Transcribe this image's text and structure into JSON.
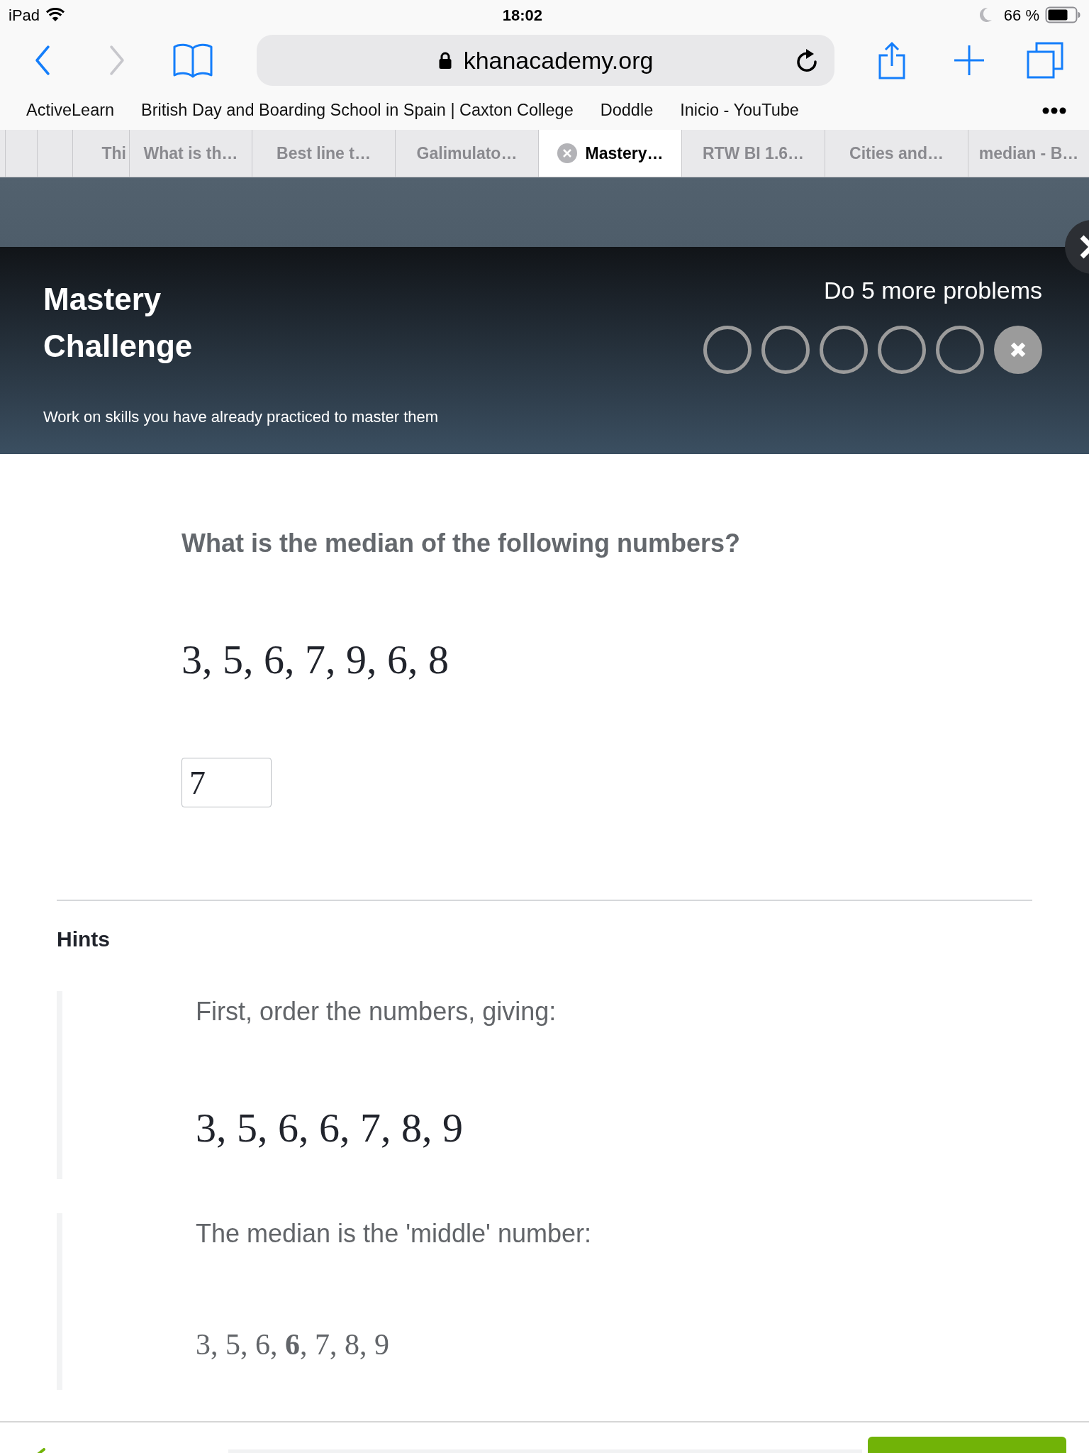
{
  "status_bar": {
    "device": "iPad",
    "time": "18:02",
    "battery": "66 %"
  },
  "toolbar": {
    "buttons": [
      {
        "kind": "back",
        "disabled": false
      },
      {
        "kind": "forward",
        "disabled": true
      },
      {
        "kind": "bookmarks",
        "disabled": false
      }
    ],
    "url": "khanacademy.org",
    "actions": [
      {
        "kind": "share"
      },
      {
        "kind": "new_tab"
      },
      {
        "kind": "tabs"
      }
    ]
  },
  "bookmarks": [
    "ActiveLearn",
    "British Day and Boarding School in Spain | Caxton College",
    "Doddle",
    "Inicio - YouTube"
  ],
  "tabs": [
    {
      "kind": "stub",
      "selected": false
    },
    {
      "kind": "stub",
      "selected": false
    },
    {
      "kind": "stub",
      "selected": false
    },
    {
      "kind": "page",
      "label": "Thi",
      "selected": false
    },
    {
      "kind": "page",
      "label": "What is th…",
      "selected": false
    },
    {
      "kind": "page",
      "label": "Best line t…",
      "selected": false
    },
    {
      "kind": "page",
      "label": "Galimulato…",
      "selected": false
    },
    {
      "kind": "page",
      "label": "Mastery…",
      "selected": true
    },
    {
      "kind": "page",
      "label": "RTW BI 1.6…",
      "selected": false
    },
    {
      "kind": "page",
      "label": "Cities and…",
      "selected": false
    },
    {
      "kind": "page",
      "label": "median - B…",
      "selected": false
    }
  ],
  "challenge": {
    "title": "Mastery Challenge",
    "subtitle": "Work on skills you have already practiced to master them",
    "progress_label": "Do 5 more problems",
    "steps": [
      {
        "kind": "empty"
      },
      {
        "kind": "empty"
      },
      {
        "kind": "empty"
      },
      {
        "kind": "empty"
      },
      {
        "kind": "empty"
      },
      {
        "kind": "wrong"
      }
    ]
  },
  "question": {
    "prompt": "What is the median of the following numbers?",
    "numbers": "3, 5, 6, 7, 9, 6, 8",
    "answer": "7"
  },
  "hints": {
    "title": "Hints",
    "items": [
      {
        "kind": "display",
        "text": "First, order the numbers, giving:",
        "math": "3, 5, 6, 6, 7, 8, 9"
      },
      {
        "kind": "inline",
        "text": "The median is the 'middle' number:",
        "math": "3, 5, 6, **6**, 7, 8, 9"
      }
    ]
  }
}
